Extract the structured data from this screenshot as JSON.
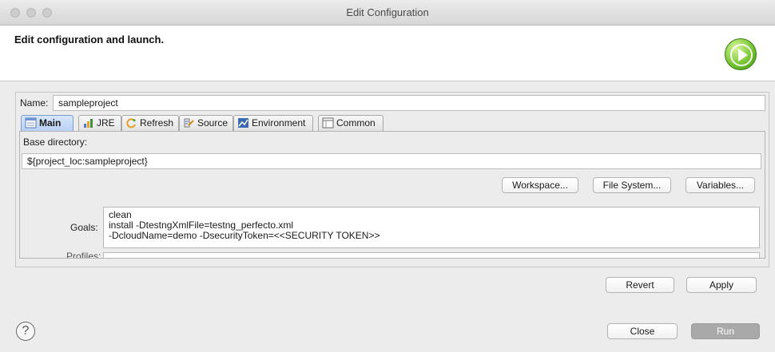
{
  "window": {
    "title": "Edit Configuration"
  },
  "banner": {
    "title": "Edit configuration and launch."
  },
  "name": {
    "label": "Name:",
    "value": "sampleproject"
  },
  "tabs": [
    {
      "label": "Main",
      "icon": "main-tab-icon"
    },
    {
      "label": "JRE",
      "icon": "jre-icon"
    },
    {
      "label": "Refresh",
      "icon": "refresh-icon"
    },
    {
      "label": "Source",
      "icon": "source-icon"
    },
    {
      "label": "Environment",
      "icon": "environment-icon"
    },
    {
      "label": "Common",
      "icon": "common-icon"
    }
  ],
  "main": {
    "base_dir_label": "Base directory:",
    "base_dir_value": "${project_loc:sampleproject}",
    "workspace_btn": "Workspace...",
    "filesystem_btn": "File System...",
    "variables_btn": "Variables...",
    "goals_label": "Goals:",
    "goals_value": "clean\ninstall -DtestngXmlFile=testng_perfecto.xml\n-DcloudName=demo -DsecurityToken=<<SECURITY TOKEN>>",
    "profiles_label_partial": "Profiles:"
  },
  "actions": {
    "revert": "Revert",
    "apply": "Apply"
  },
  "footer": {
    "help_icon": "help-icon",
    "close": "Close",
    "run": "Run"
  },
  "colors": {
    "active_tab": "#b9d1f3",
    "run_button": "#a9a9a9",
    "run_icon": "#6fc12c"
  }
}
